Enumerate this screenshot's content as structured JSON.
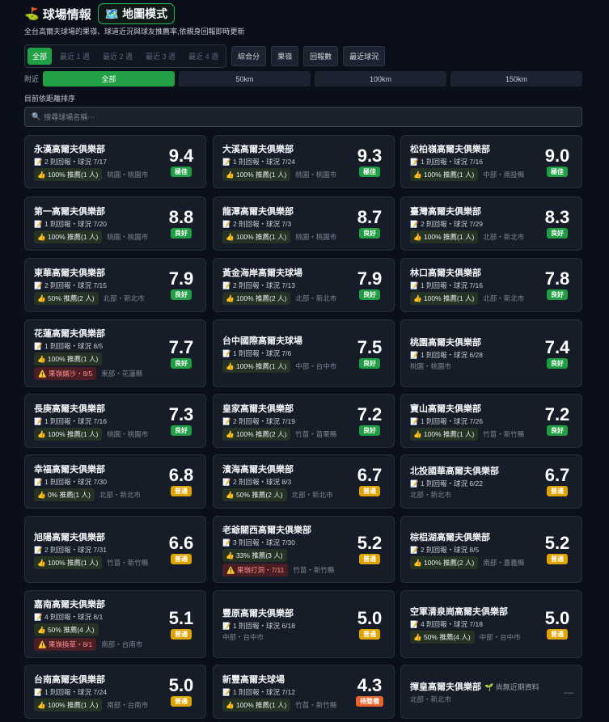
{
  "header": {
    "flag_icon": "⛳",
    "title": "球場情報",
    "map_icon": "🗺️",
    "map_label": "地圖模式",
    "subtitle": "全台高爾夫球場的果嶺、球道近況與球友推薦率,依親身回報即時更新"
  },
  "time_filters": [
    {
      "label": "全部",
      "active": true
    },
    {
      "label": "最近 1 週",
      "active": false
    },
    {
      "label": "最近 2 週",
      "active": false
    },
    {
      "label": "最近 3 週",
      "active": false
    },
    {
      "label": "最近 4 週",
      "active": false
    }
  ],
  "sort_buttons": [
    "綜合分",
    "果嶺",
    "回報數",
    "最近球況"
  ],
  "nearby": {
    "label": "附近",
    "options": [
      {
        "label": "全部",
        "active": true
      },
      {
        "label": "50km",
        "active": false
      },
      {
        "label": "100km",
        "active": false
      },
      {
        "label": "150km",
        "active": false
      }
    ]
  },
  "sort_note": "目前依距離排序",
  "search": {
    "placeholder": "搜尋球場名稱⋯",
    "icon": "search-icon"
  },
  "badge_colors": {
    "極佳": "#1f9e44",
    "良好": "#1f9e44",
    "普通": "#e0a400",
    "待整備": "#e8622e"
  },
  "courses": [
    {
      "name": "永漢高爾夫俱樂部",
      "meta": "📝 2 則回報・球況 7/17",
      "rec": "👍 100% 推薦(1 人)",
      "region": "桃園・桃園市",
      "warning": "",
      "score": "9.4",
      "badge": "極佳",
      "no_data": ""
    },
    {
      "name": "大溪高爾夫俱樂部",
      "meta": "📝 1 則回報・球況 7/24",
      "rec": "👍 100% 推薦(1 人)",
      "region": "桃園・桃園市",
      "warning": "",
      "score": "9.3",
      "badge": "極佳",
      "no_data": ""
    },
    {
      "name": "松柏嶺高爾夫俱樂部",
      "meta": "📝 1 則回報・球況 7/16",
      "rec": "👍 100% 推薦(1 人)",
      "region": "中部・南投縣",
      "warning": "",
      "score": "9.0",
      "badge": "極佳",
      "no_data": ""
    },
    {
      "name": "第一高爾夫俱樂部",
      "meta": "📝 1 則回報・球況 7/20",
      "rec": "👍 100% 推薦(1 人)",
      "region": "桃園・桃園市",
      "warning": "",
      "score": "8.8",
      "badge": "良好",
      "no_data": ""
    },
    {
      "name": "龍潭高爾夫俱樂部",
      "meta": "📝 2 則回報・球況 7/3",
      "rec": "👍 100% 推薦(1 人)",
      "region": "桃園・桃園市",
      "warning": "",
      "score": "8.7",
      "badge": "良好",
      "no_data": ""
    },
    {
      "name": "臺灣高爾夫俱樂部",
      "meta": "📝 2 則回報・球況 7/29",
      "rec": "👍 100% 推薦(1 人)",
      "region": "北部・新北市",
      "warning": "",
      "score": "8.3",
      "badge": "良好",
      "no_data": ""
    },
    {
      "name": "東華高爾夫俱樂部",
      "meta": "📝 2 則回報・球況 7/15",
      "rec": "👍 50% 推薦(2 人)",
      "region": "北部・新北市",
      "warning": "",
      "score": "7.9",
      "badge": "良好",
      "no_data": ""
    },
    {
      "name": "黃金海岸高爾夫球場",
      "meta": "📝 2 則回報・球況 7/13",
      "rec": "👍 100% 推薦(2 人)",
      "region": "北部・新北市",
      "warning": "",
      "score": "7.9",
      "badge": "良好",
      "no_data": ""
    },
    {
      "name": "林口高爾夫俱樂部",
      "meta": "📝 1 則回報・球況 7/16",
      "rec": "👍 100% 推薦(1 人)",
      "region": "北部・新北市",
      "warning": "",
      "score": "7.8",
      "badge": "良好",
      "no_data": ""
    },
    {
      "name": "花蓮高爾夫俱樂部",
      "meta": "📝 1 則回報・球況 8/5",
      "rec": "👍 100% 推薦(1 人)",
      "region": "東部・花蓮縣",
      "warning": "⚠️ 果嶺鋪沙・8/5",
      "score": "7.7",
      "badge": "良好",
      "no_data": ""
    },
    {
      "name": "台中國際高爾夫球場",
      "meta": "📝 1 則回報・球況 7/6",
      "rec": "👍 100% 推薦(1 人)",
      "region": "中部・台中市",
      "warning": "",
      "score": "7.5",
      "badge": "良好",
      "no_data": ""
    },
    {
      "name": "桃園高爾夫俱樂部",
      "meta": "📝 1 則回報・球況 6/28",
      "rec": "",
      "region": "桃園・桃園市",
      "warning": "",
      "score": "7.4",
      "badge": "良好",
      "no_data": ""
    },
    {
      "name": "長庚高爾夫俱樂部",
      "meta": "📝 1 則回報・球況 7/16",
      "rec": "👍 100% 推薦(1 人)",
      "region": "桃園・桃園市",
      "warning": "",
      "score": "7.3",
      "badge": "良好",
      "no_data": ""
    },
    {
      "name": "皇家高爾夫俱樂部",
      "meta": "📝 2 則回報・球況 7/19",
      "rec": "👍 100% 推薦(2 人)",
      "region": "竹苗・苗栗縣",
      "warning": "",
      "score": "7.2",
      "badge": "良好",
      "no_data": ""
    },
    {
      "name": "寶山高爾夫俱樂部",
      "meta": "📝 1 則回報・球況 7/26",
      "rec": "👍 100% 推薦(1 人)",
      "region": "竹苗・新竹縣",
      "warning": "",
      "score": "7.2",
      "badge": "良好",
      "no_data": ""
    },
    {
      "name": "幸福高爾夫俱樂部",
      "meta": "📝 1 則回報・球況 7/30",
      "rec": "👍 0% 推薦(1 人)",
      "region": "北部・新北市",
      "warning": "",
      "score": "6.8",
      "badge": "普通",
      "no_data": ""
    },
    {
      "name": "濱海高爾夫俱樂部",
      "meta": "📝 2 則回報・球況 8/3",
      "rec": "👍 50% 推薦(2 人)",
      "region": "北部・新北市",
      "warning": "",
      "score": "6.7",
      "badge": "普通",
      "no_data": ""
    },
    {
      "name": "北投國華高爾夫俱樂部",
      "meta": "📝 1 則回報・球況 6/22",
      "rec": "",
      "region": "北部・新北市",
      "warning": "",
      "score": "6.7",
      "badge": "普通",
      "no_data": ""
    },
    {
      "name": "旭陽高爾夫俱樂部",
      "meta": "📝 2 則回報・球況 7/31",
      "rec": "👍 100% 推薦(1 人)",
      "region": "竹苗・新竹縣",
      "warning": "",
      "score": "6.6",
      "badge": "普通",
      "no_data": ""
    },
    {
      "name": "老爺關西高爾夫俱樂部",
      "meta": "📝 3 則回報・球況 7/30",
      "rec": "👍 33% 推薦(3 人)",
      "region": "竹苗・新竹縣",
      "warning": "⚠️ 果嶺打洞・7/11",
      "score": "5.2",
      "badge": "普通",
      "no_data": ""
    },
    {
      "name": "棕梠湖高爾夫俱樂部",
      "meta": "📝 2 則回報・球況 8/5",
      "rec": "👍 100% 推薦(2 人)",
      "region": "南部・嘉義縣",
      "warning": "",
      "score": "5.2",
      "badge": "普通",
      "no_data": ""
    },
    {
      "name": "嘉南高爾夫俱樂部",
      "meta": "📝 4 則回報・球況 8/1",
      "rec": "👍 50% 推薦(4 人)",
      "region": "南部・台南市",
      "warning": "⚠️ 果嶺換草・8/1",
      "score": "5.1",
      "badge": "普通",
      "no_data": ""
    },
    {
      "name": "豐原高爾夫俱樂部",
      "meta": "📝 1 則回報・球況 6/18",
      "rec": "",
      "region": "中部・台中市",
      "warning": "",
      "score": "5.0",
      "badge": "普通",
      "no_data": ""
    },
    {
      "name": "空軍清泉崗高爾夫俱樂部",
      "meta": "📝 4 則回報・球況 7/18",
      "rec": "👍 50% 推薦(4 人)",
      "region": "中部・台中市",
      "warning": "",
      "score": "5.0",
      "badge": "普通",
      "no_data": ""
    },
    {
      "name": "台南高爾夫俱樂部",
      "meta": "📝 1 則回報・球況 7/24",
      "rec": "👍 100% 推薦(1 人)",
      "region": "南部・台南市",
      "warning": "",
      "score": "5.0",
      "badge": "普通",
      "no_data": ""
    },
    {
      "name": "新豐高爾夫球場",
      "meta": "📝 1 則回報・球況 7/12",
      "rec": "👍 100% 推薦(1 人)",
      "region": "竹苗・新竹縣",
      "warning": "",
      "score": "4.3",
      "badge": "待整備",
      "no_data": ""
    },
    {
      "name": "揮皇高爾夫俱樂部",
      "meta": "",
      "rec": "",
      "region": "北部・新北市",
      "warning": "",
      "score": "",
      "badge": "",
      "no_data": "🌱 尚無近期資料",
      "dash": "—"
    }
  ]
}
